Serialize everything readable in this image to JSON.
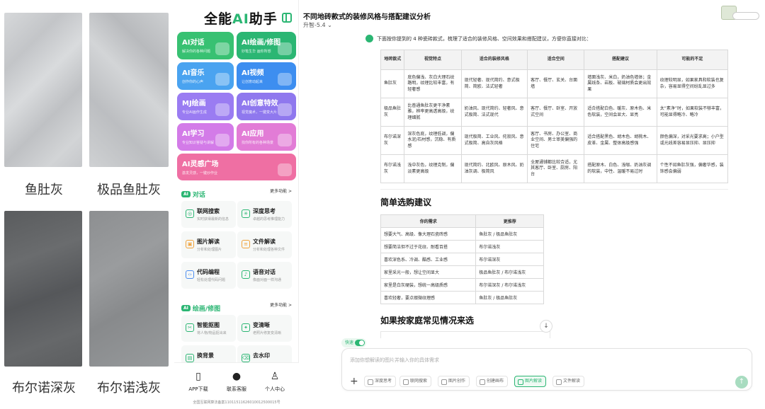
{
  "tiles": [
    {
      "caption": "鱼肚灰"
    },
    {
      "caption": "极品鱼肚灰"
    },
    {
      "caption": "布尔诺深灰"
    },
    {
      "caption": "布尔诺浅灰"
    }
  ],
  "app": {
    "logo_prefix": "全能",
    "logo_ai": "AI",
    "logo_suffix": "助手",
    "cards": [
      {
        "title": "AI对话",
        "sub": "解决你的各种问题",
        "color": "#38c172"
      },
      {
        "title": "AI绘画/修图",
        "sub": "妙笔生华 画你所想",
        "color": "#2bb673"
      },
      {
        "title": "AI音乐",
        "sub": "创作你的心声",
        "color": "#4aa3f0"
      },
      {
        "title": "AI视频",
        "sub": "让创意动起来",
        "color": "#3d8ef0"
      },
      {
        "title": "MJ绘画",
        "sub": "专业AI画作生成",
        "color": "#9a7cf2"
      },
      {
        "title": "AI创意特效",
        "sub": "视觉魔术，一键变大片",
        "color": "#8f78ee"
      },
      {
        "title": "AI学习",
        "sub": "专业知识答疑与讲解",
        "color": "#d37be8"
      },
      {
        "title": "AI应用",
        "sub": "找你所有的各种场景",
        "color": "#e27cd6"
      },
      {
        "title": "AI灵感广场",
        "sub": "激发灵感，一键炒作业",
        "color": "#ef6fa3"
      }
    ],
    "section_chat": {
      "badge": "AI",
      "title": "对话",
      "more": "更多功能 >"
    },
    "chat_features": [
      {
        "title": "联网搜索",
        "sub": "实时获得最新的信息",
        "icon": "globe-icon",
        "glyph": "◎",
        "tone": ""
      },
      {
        "title": "深度思考",
        "sub": "卓越的思考推理能力",
        "icon": "brain-icon",
        "glyph": "✳",
        "tone": ""
      },
      {
        "title": "图片解读",
        "sub": "分析和处理图片",
        "icon": "image-icon",
        "glyph": "▣",
        "tone": "orange"
      },
      {
        "title": "文件解读",
        "sub": "分析和处理各种文件",
        "icon": "file-icon",
        "glyph": "≡",
        "tone": "orange"
      },
      {
        "title": "代码编程",
        "sub": "轻松处理代码问题",
        "icon": "code-icon",
        "glyph": "‹›",
        "tone": "blue"
      },
      {
        "title": "语音对话",
        "sub": "像面对面一样沟通",
        "icon": "mic-icon",
        "glyph": "♪",
        "tone": ""
      }
    ],
    "section_paint": {
      "badge": "AI",
      "title": "绘画/修图",
      "more": "更多功能 >"
    },
    "paint_features": [
      {
        "title": "智能抠图",
        "sub": "将人物/物品抠出来",
        "icon": "scissors-icon",
        "glyph": "✂",
        "tone": ""
      },
      {
        "title": "变清晰",
        "sub": "老照片修复变清晰",
        "icon": "sparkle-icon",
        "glyph": "✦",
        "tone": ""
      },
      {
        "title": "换背景",
        "sub": "",
        "icon": "background-icon",
        "glyph": "▤",
        "tone": ""
      },
      {
        "title": "去水印",
        "sub": "",
        "icon": "eraser-icon",
        "glyph": "⌫",
        "tone": ""
      }
    ],
    "bottom_nav": [
      {
        "label": "APP下载",
        "icon": "phone-icon",
        "glyph": "▯"
      },
      {
        "label": "联系客服",
        "icon": "support-avatar-icon",
        "glyph": "●"
      },
      {
        "label": "个人中心",
        "icon": "user-icon",
        "glyph": "♙"
      }
    ],
    "icp": "全国互联网算法备案11011511626010012500015号"
  },
  "chat": {
    "title": "不同地砖款式的装修风格与搭配建议分析",
    "model": "升智-5.4",
    "intro": "下面按你提到的 4 种瓷砖款式，梳理了适合的装修风格、空间效果和搭配建议，方便你直接对比：",
    "table1": {
      "headers": [
        "地砖款式",
        "视觉特点",
        "适合的装修风格",
        "适合空间",
        "搭配建议",
        "可能的不足"
      ],
      "rows": [
        [
          "鱼肚灰",
          "底色偏浅、灰白大理石纹路明，纹理比较丰富，有轻奢感",
          "现代轻奢、现代简约、意式极简、简欧、法式轻奢",
          "客厅、餐厅、玄关、台面墙",
          "墙面浅灰、米白，奶油色墙体；金属线条、岩板、玻璃材质会更出效果",
          "纹理较明显，如果家具和软装也复杂，容易显得空间纷乱显过多"
        ],
        [
          "极品鱼肚灰",
          "比普通鱼肚灰更干净素雅，辨率更高透高级，纹理细腻",
          "奶油风、现代简约、轻奢风、意式极简、法式现代",
          "客厅、餐厅、卧室、开放式空间",
          "适合搭配白色、暖灰、原木色、米色软装，空间会显大、显亮",
          "太“素净”时，如果软装不够丰富，可能显得略冷、略冷"
        ],
        [
          "布尔诺深灰",
          "深灰色底，纹理低调，偏水泥/石材感，沉稳、有质感",
          "现代极简、工业风、侘寂风、意式极简、高自灰风格",
          "客厅、书房、办公室、商业空间、男士审美偏强的住宅",
          "适合搭配黑色、胡木色、胡桃木、皮革、金属、整体高级感强",
          "颜色偏深，对采光要求高；小户型或光线差容易显压抑、显压抑"
        ],
        [
          "布尔诺浅灰",
          "浅中灰色，纹理克制，偏淡素更高级",
          "现代简约、北欧风、原木风、奶油灰调、极简风",
          "全屋通铺都比较合适，尤其客厅、卧室、厨房、阳台",
          "搭配原木、白色、浅咖、奶油灰调的软装，中性、温暖不易过时",
          "个性不如鱼肚灰强，偏奢华感，装饰感会偏弱"
        ]
      ]
    },
    "h2_selection": "简单选购建议",
    "table2": {
      "headers": [
        "你的需求",
        "更推荐"
      ],
      "rows": [
        [
          "想要大气、高级、像大理石瓷砖感",
          "鱼肚灰 / 极品鱼肚灰"
        ],
        [
          "想要简洁但不过于花纹、耐看百搭",
          "布尔诺浅灰"
        ],
        [
          "喜欢深色系、冷调、酷感、工业感",
          "布尔诺深灰"
        ],
        [
          "家里采光一般，想让空间显大",
          "极品鱼肚灰 / 布尔诺浅灰"
        ],
        [
          "家里是白灰硬装，想统一高级质感",
          "布尔诺深灰 / 布尔诺浅灰"
        ],
        [
          "喜欢轻奢，要点缀微纹理感",
          "鱼肚灰 / 极品鱼肚灰"
        ]
      ]
    },
    "h2_family": "如果按家庭常见情况来选",
    "fast_label": "快速",
    "input_placeholder": "添加你想解读的图片并输入你的具体需求",
    "tools": [
      {
        "label": "深度思考",
        "active": false
      },
      {
        "label": "联网搜索",
        "active": false
      },
      {
        "label": "图片创作",
        "active": false
      },
      {
        "label": "创建画布",
        "active": false
      },
      {
        "label": "图片解读",
        "active": true
      },
      {
        "label": "文件解读",
        "active": false
      }
    ],
    "scroll_glyph": "↓",
    "send_glyph": "↑",
    "plus_glyph": "+"
  }
}
